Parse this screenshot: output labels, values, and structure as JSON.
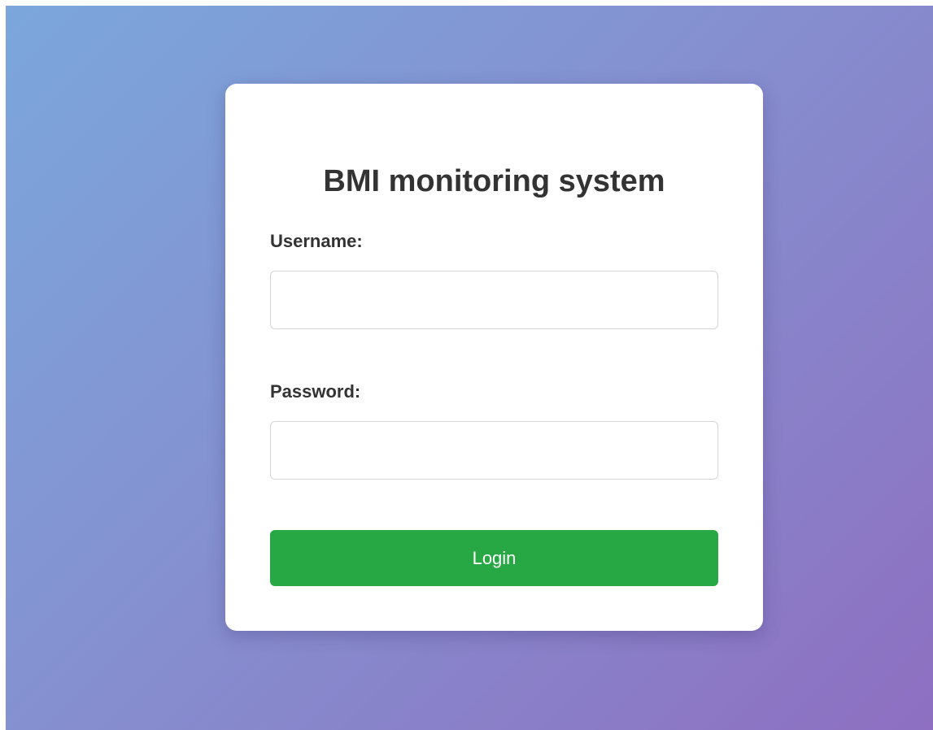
{
  "login_form": {
    "title": "BMI monitoring system",
    "username_label": "Username:",
    "username_value": "",
    "password_label": "Password:",
    "password_value": "",
    "login_label": "Login"
  },
  "colors": {
    "background_gradient_start": "#7ba7dc",
    "background_gradient_end": "#8e6fc1",
    "button": "#28a745",
    "button_text": "#ffffff",
    "text": "#333333"
  }
}
